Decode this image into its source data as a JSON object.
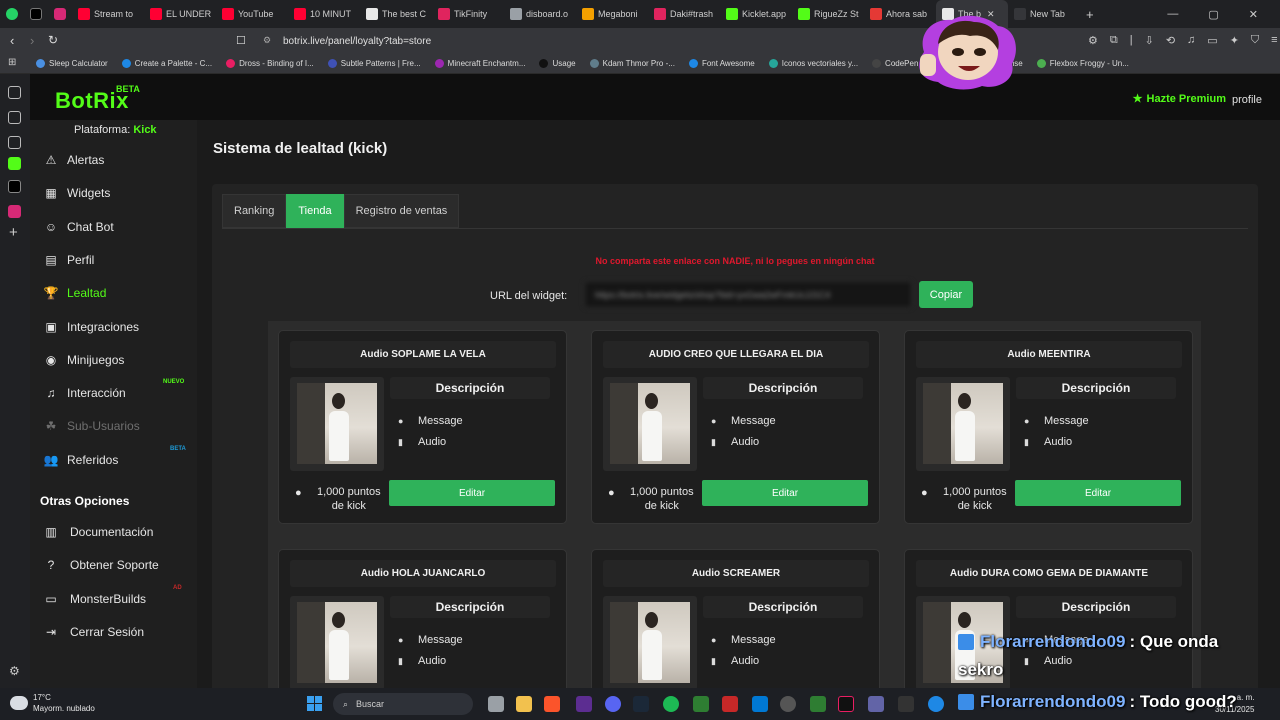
{
  "browser": {
    "tabs": [
      {
        "label": "Stream to",
        "color": "#ff0033"
      },
      {
        "label": "EL UNDER",
        "color": "#ff0033"
      },
      {
        "label": "YouTube",
        "color": "#ff0033"
      },
      {
        "label": "10 MINUT",
        "color": "#ff0033"
      },
      {
        "label": "The best C",
        "color": "#e8e8e8"
      },
      {
        "label": "TikFinity",
        "color": "#e0245e"
      },
      {
        "label": "disboard.o",
        "color": "#9aa0a6"
      },
      {
        "label": "Megaboni",
        "color": "#f4a000"
      },
      {
        "label": "Daki#trash",
        "color": "#e0245e"
      },
      {
        "label": "Kicklet.app",
        "color": "#53fc18"
      },
      {
        "label": "RigueZz St",
        "color": "#53fc18"
      },
      {
        "label": "Ahora sab",
        "color": "#e53935"
      },
      {
        "label": "The b",
        "color": "#e8e8e8"
      },
      {
        "label": "New Tab",
        "color": "#35363a"
      }
    ],
    "url": "botrix.live/panel/loyalty?tab=store",
    "bookmarks": [
      "Sleep Calculator",
      "Create a Palette - C...",
      "Dross - Binding of I...",
      "Subtle Patterns | Fre...",
      "Minecraft Enchantm...",
      "Usage",
      "Kdam Thmor Pro -...",
      "Font Awesome",
      "Iconos vectoriales y...",
      "CodePen",
      "ense",
      "Flexbox Froggy - Un..."
    ]
  },
  "app": {
    "logo": "BotRix",
    "logo_badge": "BETA",
    "premium": "Hazte Premium",
    "profile": "profile",
    "platform_label": "Plataforma:",
    "platform_value": "Kick"
  },
  "sidebar": {
    "items": [
      {
        "label": "Alertas",
        "icon": "⚠"
      },
      {
        "label": "Widgets",
        "icon": "▦"
      },
      {
        "label": "Chat Bot",
        "icon": "☺"
      },
      {
        "label": "Perfil",
        "icon": "▤"
      },
      {
        "label": "Lealtad",
        "icon": "🏆"
      },
      {
        "label": "Integraciones",
        "icon": "▣"
      },
      {
        "label": "Minijuegos",
        "icon": "◉"
      },
      {
        "label": "Interacción",
        "icon": "♫",
        "badge": "NUEVO"
      },
      {
        "label": "Sub-Usuarios",
        "icon": "☘"
      },
      {
        "label": "Referidos",
        "icon": "👥",
        "badge": "BETA"
      }
    ],
    "other_title": "Otras Opciones",
    "other_items": [
      {
        "label": "Documentación",
        "icon": "▥"
      },
      {
        "label": "Obtener Soporte",
        "icon": "?"
      },
      {
        "label": "MonsterBuilds",
        "icon": "▭",
        "badge": "AD"
      },
      {
        "label": "Cerrar Sesión",
        "icon": "⇥"
      }
    ]
  },
  "main": {
    "title": "Sistema de lealtad (kick)",
    "tabs": [
      "Ranking",
      "Tienda",
      "Registro de ventas"
    ],
    "warning": "No comparta este enlace con NADIE, ni lo pegues en ningún chat",
    "url_label": "URL del widget:",
    "url_value": "https://botrix.live/widgets/shop?bid=yxGwa2wFmkUcJJ1C4",
    "copy_button": "Copiar",
    "desc_title": "Descripción",
    "line_message": "Message",
    "line_audio": "Audio",
    "points_line1": "1,000 puntos",
    "points_line2": "de kick",
    "edit_button": "Editar",
    "cards": [
      {
        "title": "Audio SOPLAME LA VELA"
      },
      {
        "title": "AUDIO CREO QUE LLEGARA EL DIA"
      },
      {
        "title": "Audio MEENTIRA"
      },
      {
        "title": "Audio HOLA JUANCARLO"
      },
      {
        "title": "Audio SCREAMER"
      },
      {
        "title": "Audio DURA COMO GEMA DE DIAMANTE"
      }
    ]
  },
  "overlay": {
    "msg1_user": "Florarrendondo09",
    "msg1_text": ": Que onda",
    "msg1_cont": "sekro",
    "msg2_user": "Florarrendondo09",
    "msg2_text": ": Todo good?"
  },
  "taskbar": {
    "temp": "17°C",
    "weather": "Mayorm. nublado",
    "search": "Buscar",
    "lang": "LAA",
    "time": "a. m.",
    "date": "30/11/2025"
  }
}
